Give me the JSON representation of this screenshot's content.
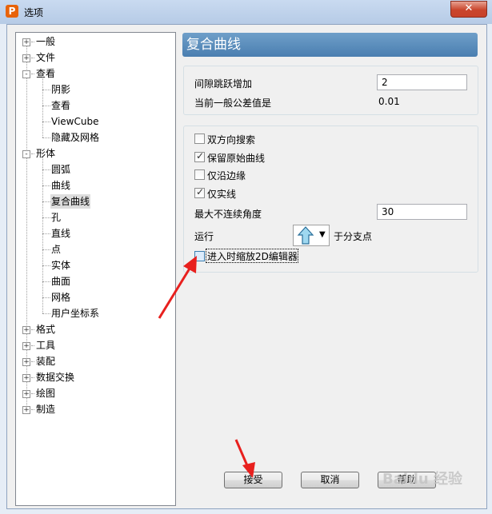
{
  "window": {
    "title": "选项",
    "app_icon_letter": "P",
    "close_label": "✕"
  },
  "tree": {
    "items": [
      {
        "label": "一般",
        "level": 0,
        "expander": "+"
      },
      {
        "label": "文件",
        "level": 0,
        "expander": "+"
      },
      {
        "label": "查看",
        "level": 0,
        "expander": "-"
      },
      {
        "label": "阴影",
        "level": 1
      },
      {
        "label": "查看",
        "level": 1
      },
      {
        "label": "ViewCube",
        "level": 1
      },
      {
        "label": "隐藏及网格",
        "level": 1
      },
      {
        "label": "形体",
        "level": 0,
        "expander": "-"
      },
      {
        "label": "圆弧",
        "level": 1
      },
      {
        "label": "曲线",
        "level": 1
      },
      {
        "label": "复合曲线",
        "level": 1,
        "selected": true
      },
      {
        "label": "孔",
        "level": 1
      },
      {
        "label": "直线",
        "level": 1
      },
      {
        "label": "点",
        "level": 1
      },
      {
        "label": "实体",
        "level": 1
      },
      {
        "label": "曲面",
        "level": 1
      },
      {
        "label": "网格",
        "level": 1
      },
      {
        "label": "用户坐标系",
        "level": 1
      },
      {
        "label": "格式",
        "level": 0,
        "expander": "+"
      },
      {
        "label": "工具",
        "level": 0,
        "expander": "+"
      },
      {
        "label": "装配",
        "level": 0,
        "expander": "+"
      },
      {
        "label": "数据交换",
        "level": 0,
        "expander": "+"
      },
      {
        "label": "绘图",
        "level": 0,
        "expander": "+"
      },
      {
        "label": "制造",
        "level": 0,
        "expander": "+"
      }
    ]
  },
  "panel": {
    "title": "复合曲线",
    "gap_label": "间隙跳跃增加",
    "gap_value": "2",
    "tolerance_label": "当前一般公差值是",
    "tolerance_value": "0.01",
    "checks": [
      {
        "label": "双方向搜索",
        "checked": false
      },
      {
        "label": "保留原始曲线",
        "checked": true
      },
      {
        "label": "仅沿边缘",
        "checked": false
      },
      {
        "label": "仅实线",
        "checked": true
      }
    ],
    "max_angle_label": "最大不连续角度",
    "max_angle_value": "30",
    "run_label": "运行",
    "run_suffix": "于分支点",
    "dropdown_arrow": "▼",
    "zoom_label": "进入时缩放2D编辑器",
    "zoom_checked": false
  },
  "buttons": {
    "accept": "接受",
    "cancel": "取消",
    "help": "帮助"
  },
  "watermark": "Baidu 经验",
  "colors": {
    "header": "#4a7eb0",
    "annotation": "#e8201e",
    "window_close": "#c9452c"
  }
}
